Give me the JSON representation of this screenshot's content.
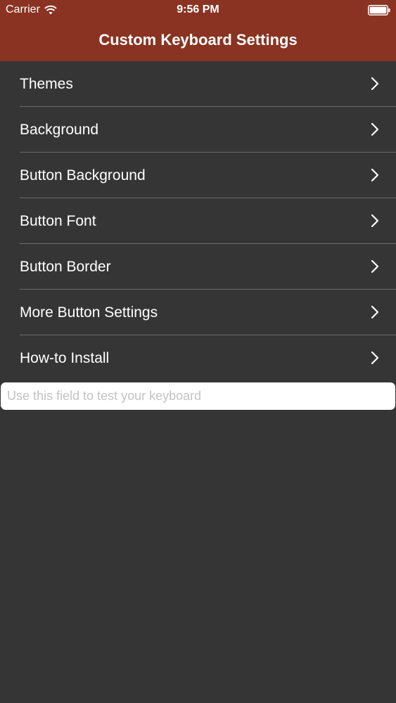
{
  "status_bar": {
    "carrier": "Carrier",
    "time": "9:56 PM",
    "wifi_icon": "wifi-icon",
    "battery_icon": "battery-icon"
  },
  "nav": {
    "title": "Custom Keyboard Settings"
  },
  "menu": {
    "items": [
      {
        "label": "Themes"
      },
      {
        "label": "Background"
      },
      {
        "label": "Button Background"
      },
      {
        "label": "Button Font"
      },
      {
        "label": "Button Border"
      },
      {
        "label": "More Button Settings"
      },
      {
        "label": "How-to Install"
      }
    ],
    "chevron_icon": "chevron-right-icon"
  },
  "test_field": {
    "value": "",
    "placeholder": "Use this field to test your keyboard"
  },
  "colors": {
    "nav_background": "#8a3322",
    "page_background": "#353535",
    "separator": "#6b6b6b",
    "text": "#ffffff"
  }
}
